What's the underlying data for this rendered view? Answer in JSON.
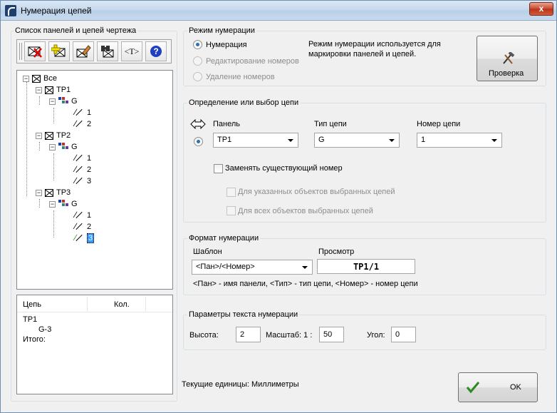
{
  "window": {
    "title": "Нумерация цепей",
    "close_label": "x"
  },
  "left": {
    "group_label": "Список панелей и цепей чертежа",
    "toolbar": {
      "buttons": [
        {
          "name": "delete",
          "icon": "delete-x-icon"
        },
        {
          "name": "add",
          "icon": "add-plus-icon"
        },
        {
          "name": "edit",
          "icon": "pencil-edit-icon"
        },
        {
          "name": "find",
          "icon": "binoculars-icon"
        },
        {
          "name": "text",
          "icon": "text-t-icon",
          "label": "<T>"
        },
        {
          "name": "help",
          "icon": "help-icon",
          "label": "?"
        }
      ]
    },
    "tree": {
      "root": "Все",
      "panels": [
        {
          "name": "TP1",
          "group": "G",
          "wires": [
            "1",
            "2"
          ]
        },
        {
          "name": "TP2",
          "group": "G",
          "wires": [
            "1",
            "2",
            "3"
          ]
        },
        {
          "name": "TP3",
          "group": "G",
          "wires": [
            "1",
            "2",
            "3"
          ],
          "selected_wire": "3"
        }
      ]
    },
    "list": {
      "col_chain": "Цепь",
      "col_count": "Кол.",
      "rows": [
        "TP1",
        "G-3",
        "Итого:"
      ]
    }
  },
  "mode": {
    "group_label": "Режим нумерации",
    "options": [
      "Нумерация",
      "Редактирование номеров",
      "Удаление номеров"
    ],
    "selected": 0,
    "description": "Режим нумерации используется для маркировки панелей и цепей.",
    "check_button_label": "Проверка"
  },
  "chain": {
    "group_label": "Определение или выбор цепи",
    "panel_label": "Панель",
    "panel_value": "TP1",
    "type_label": "Тип цепи",
    "type_value": "G",
    "number_label": "Номер цепи",
    "number_value": "1",
    "replace_label": "Заменять существующий номер",
    "for_selected_label": "Для указанных объектов выбранных цепей",
    "for_all_label": "Для всех объектов выбранных цепей"
  },
  "format": {
    "group_label": "Формат нумерации",
    "template_label": "Шаблон",
    "template_value": "<Пан>/<Номер>",
    "preview_label": "Просмотр",
    "preview_value": "TP1/1",
    "hint": "<Пан> - имя панели, <Тип> - тип цепи, <Номер> - номер цепи"
  },
  "text_params": {
    "group_label": "Параметры текста нумерации",
    "height_label": "Высота:",
    "height_value": "2",
    "scale_label": "Масштаб: 1 :",
    "scale_value": "50",
    "angle_label": "Угол:",
    "angle_value": "0"
  },
  "footer": {
    "units": "Текущие единицы: Миллиметры",
    "ok_label": "OK"
  },
  "colors": {
    "accent": "#3399ff",
    "ok_check": "#2a8a1f"
  }
}
